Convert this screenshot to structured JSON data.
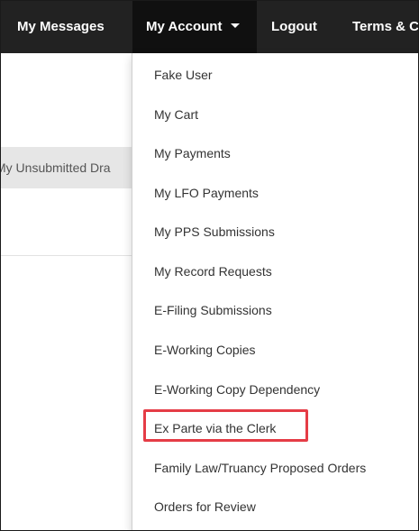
{
  "navbar": {
    "messages_label": "My Messages",
    "account_label": "My Account",
    "logout_label": "Logout",
    "terms_label": "Terms & C"
  },
  "left_panel": {
    "tab_label": "My Unsubmitted Dra"
  },
  "dropdown": {
    "items": [
      {
        "label": "Fake User"
      },
      {
        "label": "My Cart"
      },
      {
        "label": "My Payments"
      },
      {
        "label": "My LFO Payments"
      },
      {
        "label": "My PPS Submissions"
      },
      {
        "label": "My Record Requests"
      },
      {
        "label": "E-Filing Submissions"
      },
      {
        "label": "E-Working Copies"
      },
      {
        "label": "E-Working Copy Dependency"
      },
      {
        "label": "Ex Parte via the Clerk"
      },
      {
        "label": "Family Law/Truancy Proposed Orders"
      },
      {
        "label": "Orders for Review"
      }
    ],
    "highlighted_item": "Ex Parte via the Clerk"
  },
  "colors": {
    "navbar_bg": "#222222",
    "navbar_active_bg": "#101010",
    "highlight_border": "#e53c46",
    "menu_text": "#333333"
  },
  "icons": {
    "account_caret": "caret-down-icon"
  }
}
